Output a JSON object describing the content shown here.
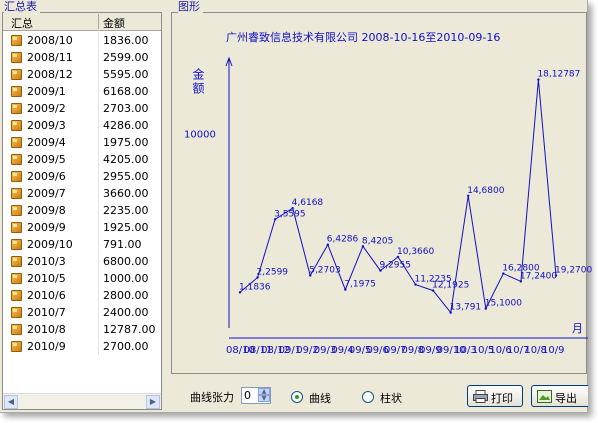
{
  "left_panel": {
    "group_title": "汇总表",
    "columns": [
      "汇总",
      "金额"
    ],
    "rows": [
      {
        "month": "2008/10",
        "amount": "1836.00"
      },
      {
        "month": "2008/11",
        "amount": "2599.00"
      },
      {
        "month": "2008/12",
        "amount": "5595.00"
      },
      {
        "month": "2009/1",
        "amount": "6168.00"
      },
      {
        "month": "2009/2",
        "amount": "2703.00"
      },
      {
        "month": "2009/3",
        "amount": "4286.00"
      },
      {
        "month": "2009/4",
        "amount": "1975.00"
      },
      {
        "month": "2009/5",
        "amount": "4205.00"
      },
      {
        "month": "2009/6",
        "amount": "2955.00"
      },
      {
        "month": "2009/7",
        "amount": "3660.00"
      },
      {
        "month": "2009/8",
        "amount": "2235.00"
      },
      {
        "month": "2009/9",
        "amount": "1925.00"
      },
      {
        "month": "2009/10",
        "amount": "791.00"
      },
      {
        "month": "2010/3",
        "amount": "6800.00"
      },
      {
        "month": "2010/5",
        "amount": "1000.00"
      },
      {
        "month": "2010/6",
        "amount": "2800.00"
      },
      {
        "month": "2010/7",
        "amount": "2400.00"
      },
      {
        "month": "2010/8",
        "amount": "12787.00"
      },
      {
        "month": "2010/9",
        "amount": "2700.00"
      }
    ]
  },
  "chart_panel": {
    "group_title": "图形"
  },
  "chart_data": {
    "type": "line",
    "title": "广州睿致信息技术有限公司  2008-10-16至2010-09-16",
    "ylabel": "金额",
    "xlabel": "月",
    "y_tick": "10000",
    "ylim": [
      0,
      14000
    ],
    "x": [
      "08/10",
      "08/11",
      "08/12",
      "09/1",
      "09/2",
      "09/3",
      "09/4",
      "09/5",
      "09/6",
      "09/7",
      "09/8",
      "09/9",
      "09/10",
      "10/3",
      "10/5",
      "10/6",
      "10/7",
      "10/8",
      "10/9"
    ],
    "point_labels": [
      "1,1836",
      "2,2599",
      "3,5595",
      "4,6168",
      "5,2703",
      "6,4286",
      "7,1975",
      "8,4205",
      "9,2955",
      "10,3660",
      "11,2235",
      "12,1925",
      "13,791",
      "14,6800",
      "15,1000",
      "16,2800",
      "17,2400",
      "18,12787",
      "19,2700"
    ],
    "values": [
      1836,
      2599,
      5595,
      6168,
      2703,
      4286,
      1975,
      4205,
      2955,
      3660,
      2235,
      1925,
      791,
      6800,
      1000,
      2800,
      2400,
      12787,
      2700
    ],
    "grid": false,
    "series_color": "#1010c8"
  },
  "controls": {
    "tension_label": "曲线张力",
    "tension_value": "0",
    "radio_curve": "曲线",
    "radio_bar": "柱状",
    "print_button": "打印",
    "export_button": "导出"
  }
}
